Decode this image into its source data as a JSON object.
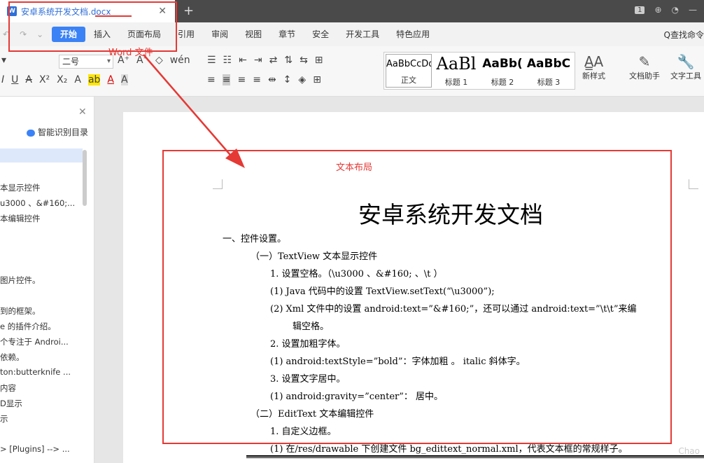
{
  "titlebar": {
    "doc_icon": "W",
    "tab_title": "安卓系统开发文档.docx",
    "close_glyph": "✕",
    "new_tab_glyph": "+",
    "badge": "1",
    "icons": [
      "window-icon",
      "share-icon",
      "user-icon",
      "minimize-icon"
    ]
  },
  "menu": {
    "items": [
      "开始",
      "插入",
      "页面布局",
      "引用",
      "审阅",
      "视图",
      "章节",
      "安全",
      "开发工具",
      "特色应用"
    ],
    "active_index": 0,
    "search": "Q查找命令"
  },
  "ribbon": {
    "font_size": "二号",
    "styles": [
      {
        "sample": "AaBbCcDd",
        "name": "正文"
      },
      {
        "sample": "AaBl",
        "name": "标题 1"
      },
      {
        "sample": "AaBb(",
        "name": "标题 2"
      },
      {
        "sample": "AaBbC",
        "name": "标题 3"
      }
    ],
    "new_style": "新样式",
    "doc_assistant": "文档助手",
    "text_tools": "文字工具"
  },
  "sidebar": {
    "smart_toc": "智能识别目录",
    "items": [
      {
        "text": "本显示控件"
      },
      {
        "text": "u3000 、&#160;..."
      },
      {
        "text": "本编辑控件"
      },
      {
        "text": "图片控件。"
      },
      {
        "text": "到的框架。"
      },
      {
        "text": "e 的插件介绍。"
      },
      {
        "text": "个专注于 Androi..."
      },
      {
        "text": "依赖。"
      },
      {
        "text": "ton:butterknife ..."
      },
      {
        "text": "内容"
      },
      {
        "text": "D显示"
      },
      {
        "text": "示"
      },
      {
        "text": "> [Plugins] --> ..."
      }
    ]
  },
  "document": {
    "title": "安卓系统开发文档",
    "lines": [
      {
        "text": "一、控件设置。"
      },
      {
        "text": "（一）TextView 文本显示控件"
      },
      {
        "text": "1. 设置空格。（\\u3000 、&#160; 、\\t ）"
      },
      {
        "text": "(1)  Java 代码中的设置 TextView.setText(“\\u3000”);"
      },
      {
        "text": "(2)  Xml 文件中的设置 android:text=”&#160;”，还可以通过 android:text=”\\t\\t”来编"
      },
      {
        "text": "辑空格。"
      },
      {
        "text": "2. 设置加粗字体。"
      },
      {
        "text": "(1)  android:textStyle=”bold”：字体加粗 。 italic 斜体字。"
      },
      {
        "text": "3. 设置文字居中。"
      },
      {
        "text": "(1)  android:gravity=”center”：  居中。"
      },
      {
        "text": "（二）EditText 文本编辑控件"
      },
      {
        "text": "1. 自定义边框。"
      },
      {
        "text": "(1)  在/res/drawable 下创建文件 bg_edittext_normal.xml，代表文本框的常规样子。"
      }
    ]
  },
  "annotations": {
    "word_file": "Word 文件",
    "text_layout": "文本布局",
    "color": "#e53935"
  },
  "watermark": "Chao"
}
